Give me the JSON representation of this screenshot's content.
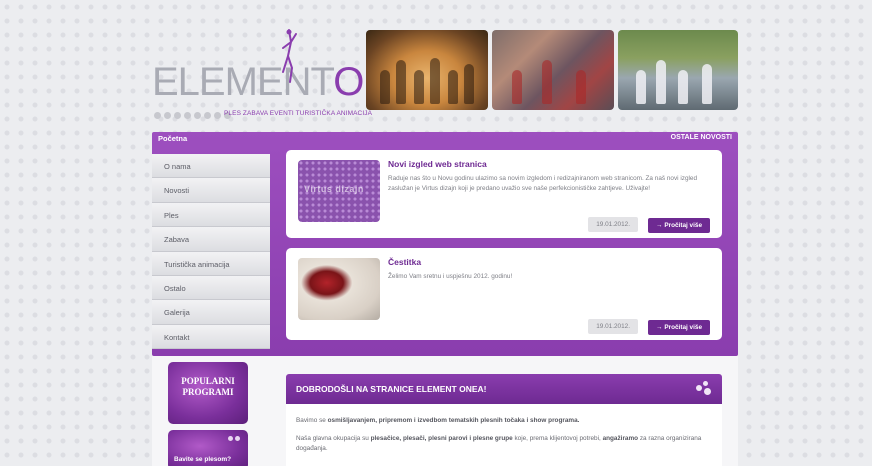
{
  "header": {
    "logo_text_grey": "ELEMENT",
    "logo_text_purple": "ONE",
    "tagline": "PLES ZABAVA EVENTI TURISTIČKA ANIMACIJA"
  },
  "nav": {
    "home_tab": "Početna",
    "other_news": "OSTALE NOVOSTI",
    "items": [
      {
        "label": "O nama"
      },
      {
        "label": "Novosti"
      },
      {
        "label": "Ples"
      },
      {
        "label": "Zabava"
      },
      {
        "label": "Turistička animacija"
      },
      {
        "label": "Ostalo"
      },
      {
        "label": "Galerija"
      },
      {
        "label": "Kontakt"
      }
    ]
  },
  "news": [
    {
      "title": "Novi izgled web stranica",
      "thumb_text": "Virtus dizajn",
      "text": "Raduje nas što u Novu godinu ulazimo sa novim izgledom i redizajniranom web stranicom. Za naš novi izgled zaslužan je Virtus dizajn koji je predano uvažio sve naše perfekcionističke zahtjeve. Uživajte!",
      "date": "19.01.2012.",
      "button": "→ Pročitaj više"
    },
    {
      "title": "Čestitka",
      "thumb_text": "",
      "text": "Želimo Vam sretnu i uspješnu 2012. godinu!",
      "date": "19.01.2012.",
      "button": "→ Pročitaj više"
    }
  ],
  "promos": {
    "popular": "POPULARNI PROGRAMI",
    "dance": "Bavite se plesom?"
  },
  "welcome": {
    "title": "DOBRODOŠLI NA STRANICE ELEMENT ONEA!",
    "p1_pre": "Bavimo se ",
    "p1_bold": "osmišljavanjem, pripremom i izvedbom tematskih plesnih točaka i show programa.",
    "p2_pre": "Naša glavna okupacija su ",
    "p2_bold1": "plesačice, plesači, plesni parovi i plesne grupe",
    "p2_mid": " koje, prema klijentovoj potrebi, ",
    "p2_bold2": "angažiramo",
    "p2_post": " za razna organizirana događanja."
  },
  "colors": {
    "brand_purple": "#8a3dae",
    "dark_purple": "#6e2a92",
    "logo_grey": "#a9abb4"
  }
}
